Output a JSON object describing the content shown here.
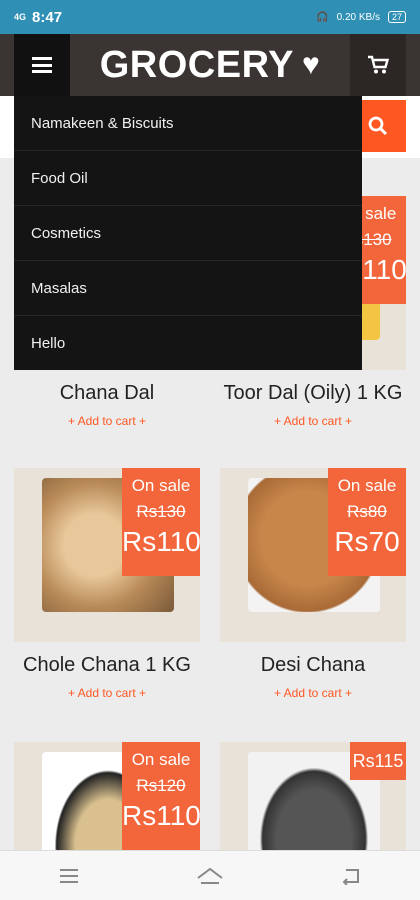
{
  "status_bar": {
    "time": "8:47",
    "network": "4G",
    "speed": "0.20 KB/s",
    "battery": "27"
  },
  "header": {
    "title": "GROCERY",
    "heart_icon": "heart-icon",
    "menu_icon": "hamburger-icon",
    "cart_icon": "cart-icon"
  },
  "search": {
    "icon": "search-icon"
  },
  "menu": {
    "items": [
      {
        "label": "Namakeen & Biscuits"
      },
      {
        "label": "Food Oil"
      },
      {
        "label": "Cosmetics"
      },
      {
        "label": "Masalas"
      },
      {
        "label": "Hello"
      }
    ]
  },
  "products": [
    {
      "name": "Chana Dal",
      "add_to_cart": "+ Add to cart +"
    },
    {
      "name": "Toor Dal (Oily) 1 KG",
      "add_to_cart": "+ Add to cart +",
      "sale_label": "On sale",
      "old_price": "Rs130",
      "new_price": "Rs110"
    },
    {
      "name": "Chole Chana 1 KG",
      "add_to_cart": "+ Add to cart +",
      "sale_label": "On sale",
      "old_price": "Rs130",
      "new_price": "Rs110"
    },
    {
      "name": "Desi Chana",
      "add_to_cart": "+ Add to cart +",
      "sale_label": "On sale",
      "old_price": "Rs80",
      "new_price": "Rs70"
    },
    {
      "sale_label": "On sale",
      "old_price": "Rs120",
      "new_price": "Rs110"
    },
    {
      "price": "Rs115"
    }
  ],
  "colors": {
    "accent": "#fe5722",
    "header_bg": "#3a3432",
    "menu_bg": "#141414",
    "status_bar": "#2f8fb5"
  },
  "nav": {
    "menu_icon": "menu-icon",
    "home_icon": "home-icon",
    "back_icon": "back-icon"
  }
}
